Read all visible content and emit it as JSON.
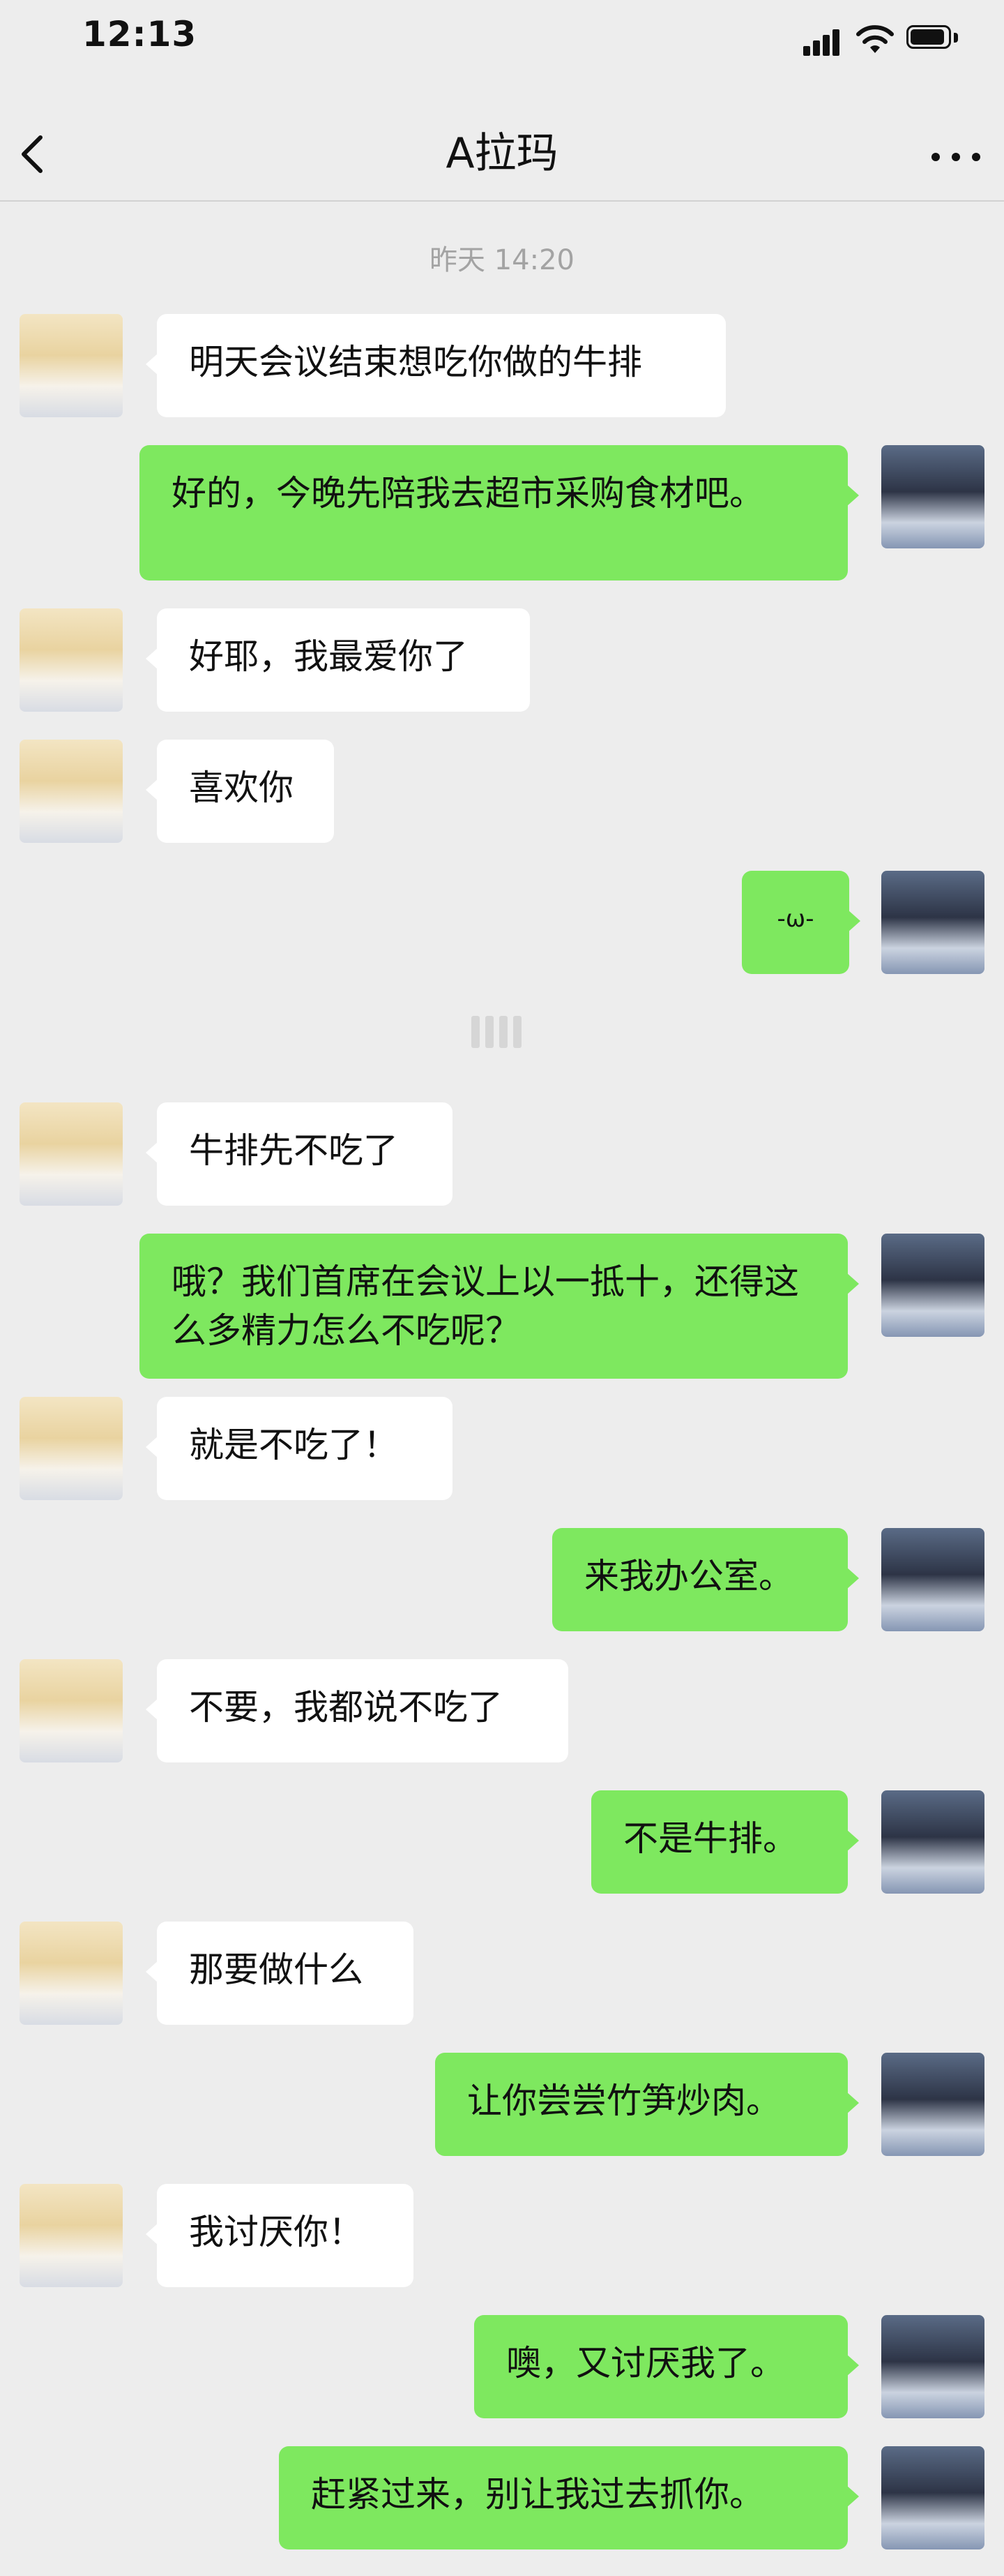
{
  "status": {
    "time": "12:13"
  },
  "header": {
    "title": "A拉玛"
  },
  "chat": {
    "timestamp": "昨天 14:20",
    "messages": [
      {
        "side": "left",
        "text": "明天会议结束想吃你做的牛排"
      },
      {
        "side": "right",
        "text": "好的，今晚先陪我去超市采购食材吧。"
      },
      {
        "side": "left",
        "text": "好耶，我最爱你了"
      },
      {
        "side": "left",
        "text": "喜欢你"
      },
      {
        "side": "right",
        "text": "-ω-"
      },
      {
        "side": "left",
        "text": "牛排先不吃了"
      },
      {
        "side": "right",
        "text": "哦？我们首席在会议上以一抵十，还得这么多精力怎么不吃呢？"
      },
      {
        "side": "left",
        "text": "就是不吃了！"
      },
      {
        "side": "right",
        "text": "来我办公室。"
      },
      {
        "side": "left",
        "text": "不要，我都说不吃了"
      },
      {
        "side": "right",
        "text": "不是牛排。"
      },
      {
        "side": "left",
        "text": "那要做什么"
      },
      {
        "side": "right",
        "text": "让你尝尝竹笋炒肉。"
      },
      {
        "side": "left",
        "text": "我讨厌你！"
      },
      {
        "side": "right",
        "text": "噢，又讨厌我了。"
      },
      {
        "side": "right",
        "text": "赶紧过来，别让我过去抓你。"
      }
    ]
  },
  "icons": {
    "back": "chevron-left-icon",
    "more": "more-dots-icon",
    "signal": "cellular-signal-icon",
    "wifi": "wifi-icon",
    "battery": "battery-icon",
    "divider": "page-divider-icon"
  },
  "colors": {
    "background": "#ededed",
    "sent_bubble": "#7ee85f",
    "received_bubble": "#ffffff",
    "timestamp": "#a3a3a3"
  }
}
